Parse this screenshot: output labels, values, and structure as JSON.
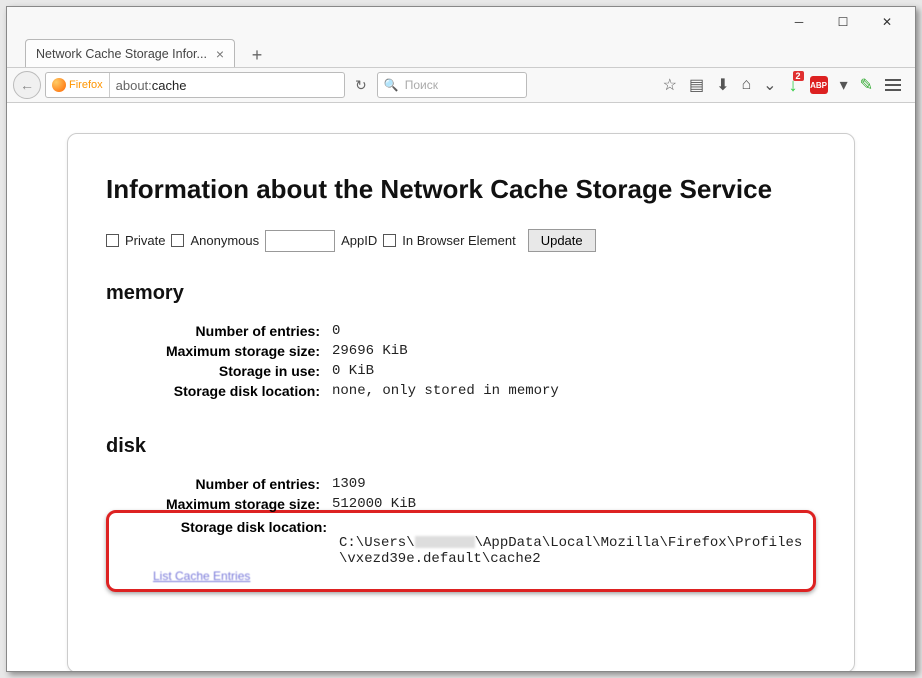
{
  "window": {
    "tab_title": "Network Cache Storage Infor..."
  },
  "nav": {
    "identity_label": "Firefox",
    "url_prefix": "about:",
    "url_page": "cache",
    "search_placeholder": "Поиск"
  },
  "toolbar": {
    "download_badge": "2",
    "abp_label": "ABP"
  },
  "page": {
    "title": "Information about the Network Cache Storage Service",
    "checkbox_private": "Private",
    "checkbox_anonymous": "Anonymous",
    "appid_label": "AppID",
    "checkbox_inbrowser": "In Browser Element",
    "update_button": "Update",
    "memory": {
      "heading": "memory",
      "entries_label": "Number of entries:",
      "entries_value": "0",
      "maxsize_label": "Maximum storage size:",
      "maxsize_value": "29696 KiB",
      "inuse_label": "Storage in use:",
      "inuse_value": "0 KiB",
      "location_label": "Storage disk location:",
      "location_value": "none, only stored in memory"
    },
    "disk": {
      "heading": "disk",
      "entries_label": "Number of entries:",
      "entries_value": "1309",
      "maxsize_label": "Maximum storage size:",
      "maxsize_value": "512000 KiB",
      "location_label": "Storage disk location:",
      "location_value_pre": "C:\\Users\\",
      "location_value_post": "\\AppData\\Local\\Mozilla\\Firefox\\Profiles\n\\vxezd39e.default\\cache2"
    }
  }
}
